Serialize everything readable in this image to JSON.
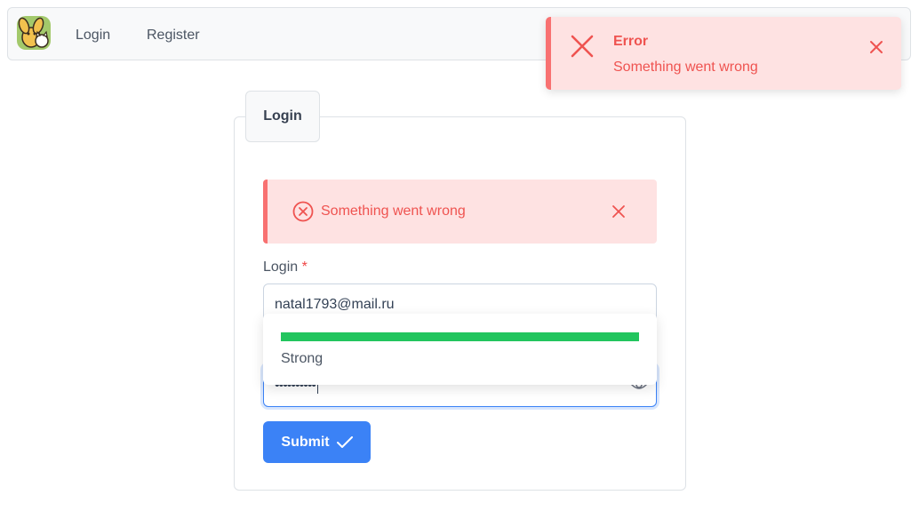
{
  "navbar": {
    "logo_icon": "dog-and-cat-logo",
    "links": [
      {
        "label": "Login"
      },
      {
        "label": "Register"
      }
    ]
  },
  "toast": {
    "title": "Error",
    "message": "Something went wrong",
    "icon": "x-icon",
    "color": "#ef5350"
  },
  "form": {
    "tab_label": "Login",
    "alert": {
      "message": "Something went wrong",
      "icon": "circle-x-icon"
    },
    "login_label": "Login",
    "required_mark": "*",
    "login_value": "natal1793@mail.ru",
    "password_masked": "••••••••••",
    "password_strength": {
      "label": "Strong",
      "level": 1.0,
      "color": "#22c55e"
    },
    "submit_label": "Submit",
    "submit_icon": "check-icon",
    "accent": "#3b82f6"
  }
}
